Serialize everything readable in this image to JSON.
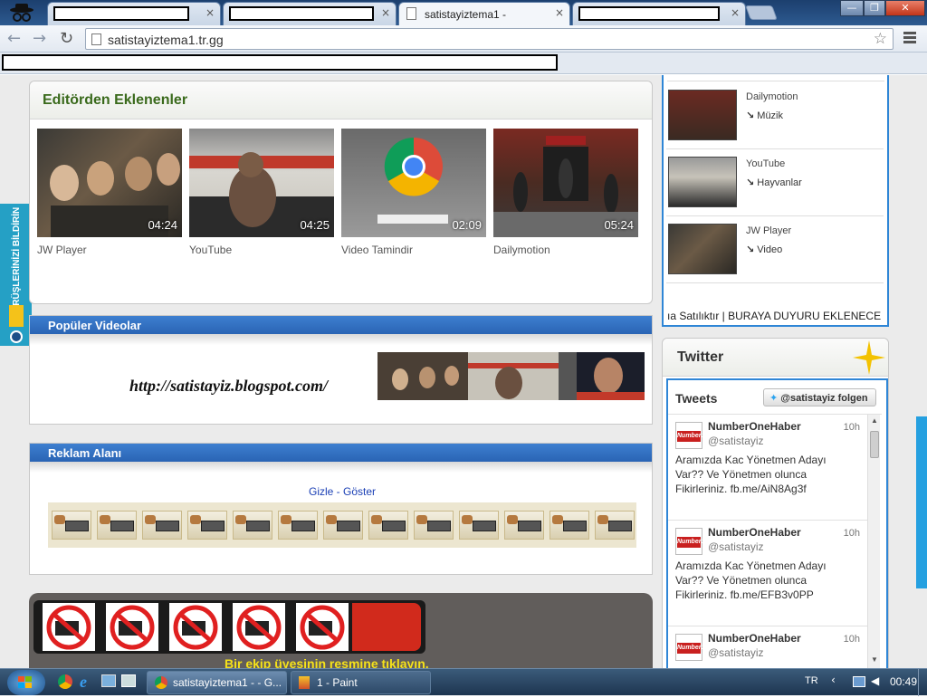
{
  "browser": {
    "tabs": [
      {
        "label": ""
      },
      {
        "label": ""
      },
      {
        "label": "satistayiztema1 -"
      },
      {
        "label": ""
      }
    ],
    "url": "satistayiztema1.tr.gg",
    "close_glyph": "×"
  },
  "editors": {
    "title": "Editörden Eklenenler",
    "videos": [
      {
        "duration": "04:24",
        "caption": "JW Player"
      },
      {
        "duration": "04:25",
        "caption": "YouTube"
      },
      {
        "duration": "02:09",
        "caption": "Video Tamindir"
      },
      {
        "duration": "05:24",
        "caption": "Dailymotion"
      }
    ]
  },
  "popular": {
    "title": "Popüler Videolar",
    "blog_link": "http://satistayiz.blogspot.com/"
  },
  "ads": {
    "title": "Reklam Alanı",
    "toggle": "Gizle - Göster",
    "banner_count": 13
  },
  "dark_panel": {
    "marquee": "Bir ekip üyesinin resmine tıklayın."
  },
  "feedback_tab": {
    "label": "GÖRÜŞLERİNİZİ BİLDİRİN"
  },
  "sidebar": {
    "items": [
      {
        "source": "Dailymotion",
        "category": "Müzik"
      },
      {
        "source": "YouTube",
        "category": "Hayvanlar"
      },
      {
        "source": "JW Player",
        "category": "Video"
      }
    ],
    "ticker": "ıa Satılıktır | BURAYA DUYURU EKLENECE"
  },
  "twitter": {
    "title": "Twitter",
    "tweets_label": "Tweets",
    "follow_button": "@satistayiz folgen",
    "tweets": [
      {
        "name": "NumberOneHaber",
        "handle": "@satistayiz",
        "time": "10h",
        "text": "Aramızda Kac Yönetmen Adayı Var?? Ve Yönetmen olunca Fikirleriniz. fb.me/AiN8Ag3f",
        "avatar": "Number1"
      },
      {
        "name": "NumberOneHaber",
        "handle": "@satistayiz",
        "time": "10h",
        "text": "Aramızda Kac Yönetmen Adayı Var?? Ve Yönetmen olunca Fikirleriniz. fb.me/EFB3v0PP",
        "avatar": "Number1"
      },
      {
        "name": "NumberOneHaber",
        "handle": "@satistayiz",
        "time": "10h",
        "text": "",
        "avatar": "Number1"
      }
    ]
  },
  "taskbar": {
    "items": [
      {
        "label": "satistayiztema1 - - G..."
      },
      {
        "label": "1 - Paint"
      }
    ],
    "language": "TR",
    "clock": "00:49"
  },
  "colors": {
    "accent_blue": "#2a64b4",
    "heading_green": "#3a6a1c",
    "sidebar_border": "#2f86d6"
  }
}
